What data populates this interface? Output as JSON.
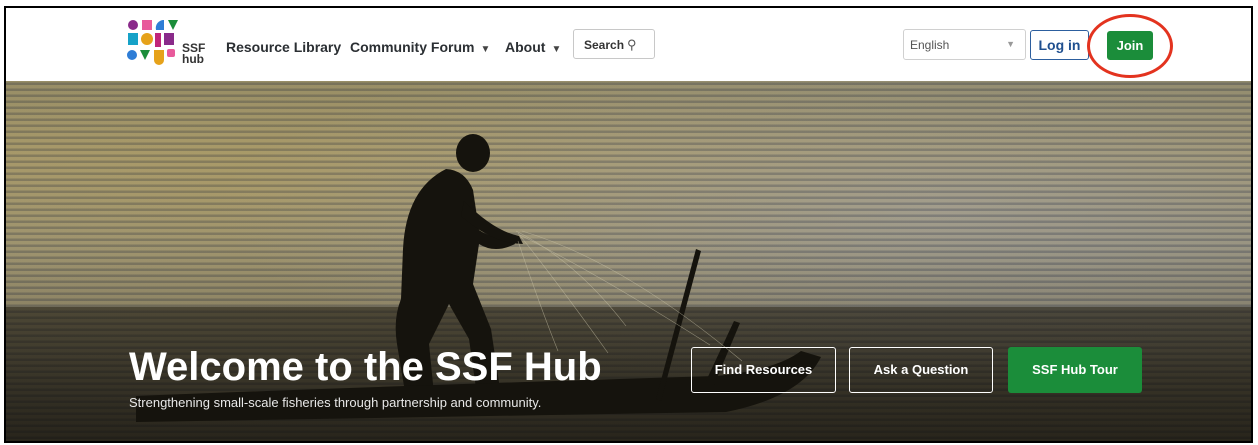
{
  "header": {
    "logo_text_line1": "SSF",
    "logo_text_line2": "hub",
    "nav": [
      {
        "label": "Resource Library"
      },
      {
        "label": "Community Forum"
      },
      {
        "label": "About"
      }
    ],
    "search_label": "Search",
    "language": "English",
    "login_label": "Log in",
    "join_label": "Join"
  },
  "hero": {
    "title": "Welcome to the SSF Hub",
    "subtitle": "Strengthening small-scale fisheries through partnership and community.",
    "buttons": [
      {
        "label": "Find Resources"
      },
      {
        "label": "Ask a Question"
      },
      {
        "label": "SSF Hub Tour"
      }
    ]
  },
  "colors": {
    "primary_green": "#1b8d3a",
    "login_blue": "#1f4f8f",
    "annotation_red": "#e3331f"
  },
  "icons": [
    "search-icon",
    "chevron-down-icon",
    "ssf-hub-logo"
  ]
}
